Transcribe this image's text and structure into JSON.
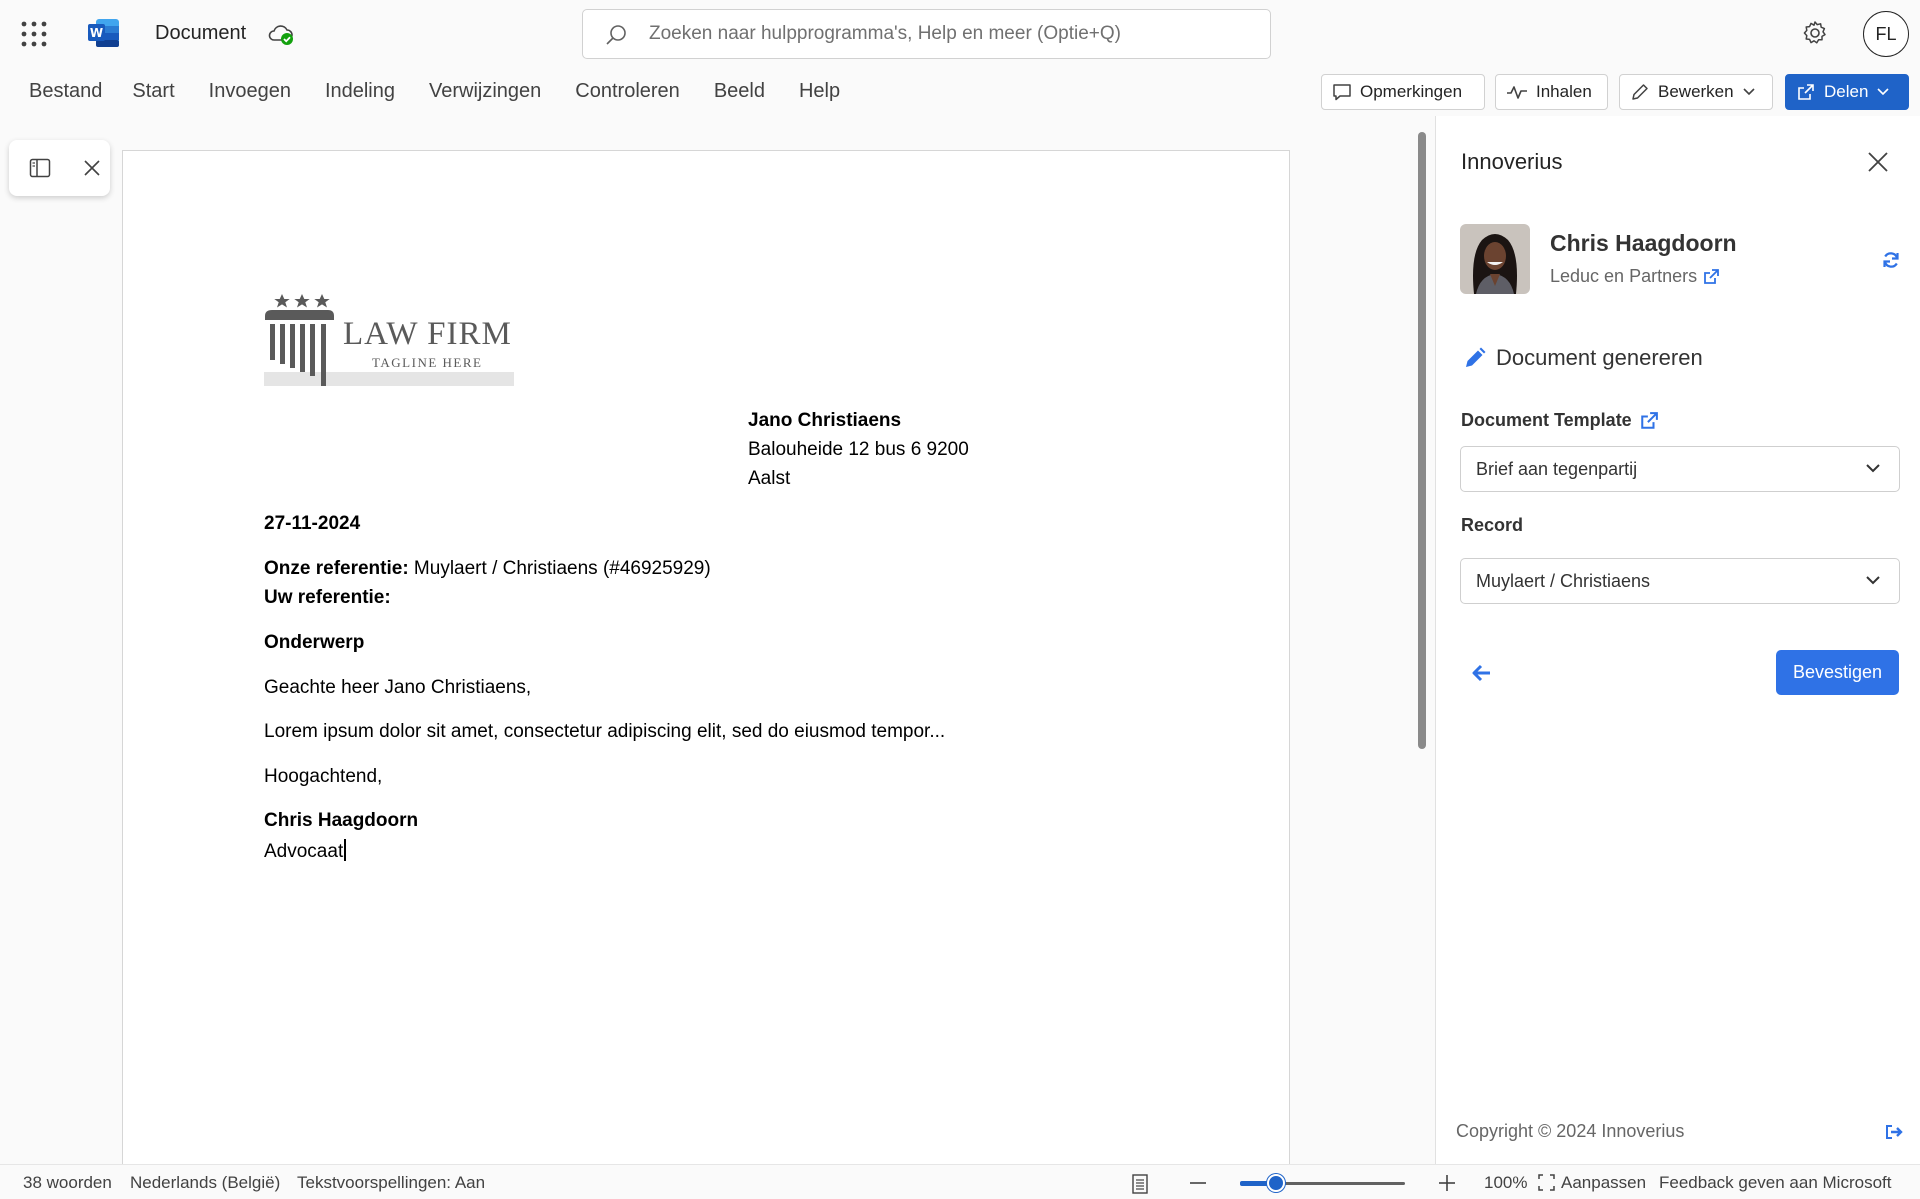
{
  "titlebar": {
    "doc_title": "Document",
    "search_placeholder": "Zoeken naar hulpprogramma's, Help en meer (Optie+Q)",
    "user_initials": "FL"
  },
  "ribbon": {
    "tabs": [
      "Bestand",
      "Start",
      "Invoegen",
      "Indeling",
      "Verwijzingen",
      "Controleren",
      "Beeld",
      "Help"
    ],
    "comments_label": "Opmerkingen",
    "catchup_label": "Inhalen",
    "edit_label": "Bewerken",
    "share_label": "Delen"
  },
  "document": {
    "logo_title": "LAW FIRM",
    "logo_tagline": "TAGLINE HERE",
    "recipient_name": "Jano Christiaens",
    "recipient_address": "Balouheide 12 bus 6 9200",
    "recipient_city": "Aalst",
    "date": "27-11-2024",
    "our_ref_label": "Onze referentie:",
    "our_ref_value": " Muylaert / Christiaens (#46925929)",
    "your_ref_label": "Uw referentie:",
    "subject": "Onderwerp",
    "salutation": "Geachte heer Jano Christiaens,",
    "body": "Lorem ipsum dolor sit amet, consectetur adipiscing elit, sed do eiusmod tempor...",
    "closing": "Hoogachtend,",
    "signer_name": "Chris Haagdoorn",
    "signer_title": "Advocaat"
  },
  "pane": {
    "title": "Innoverius",
    "user_name": "Chris Haagdoorn",
    "user_org": "Leduc en Partners",
    "section_title": "Document genereren",
    "template_label": "Document Template",
    "template_value": "Brief aan tegenpartij",
    "record_label": "Record",
    "record_value": "Muylaert / Christiaens",
    "confirm_label": "Bevestigen",
    "copyright": "Copyright © 2024 Innoverius",
    "accent_color": "#2f72e6"
  },
  "statusbar": {
    "word_count": "38 woorden",
    "language": "Nederlands (België)",
    "predictions": "Tekstvoorspellingen: Aan",
    "zoom": "100%",
    "fit_label": "Aanpassen",
    "feedback": "Feedback geven aan Microsoft",
    "zoom_level_fraction": 0.22
  }
}
